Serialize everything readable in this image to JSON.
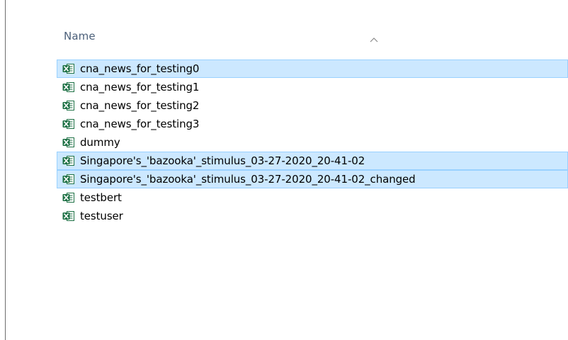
{
  "header": {
    "name_column": "Name"
  },
  "files": [
    {
      "name": "cna_news_for_testing0",
      "selected": true,
      "icon": "excel-file-icon"
    },
    {
      "name": "cna_news_for_testing1",
      "selected": false,
      "icon": "excel-file-icon"
    },
    {
      "name": "cna_news_for_testing2",
      "selected": false,
      "icon": "excel-file-icon"
    },
    {
      "name": "cna_news_for_testing3",
      "selected": false,
      "icon": "excel-file-icon"
    },
    {
      "name": "dummy",
      "selected": false,
      "icon": "excel-file-icon"
    },
    {
      "name": "Singapore's_'bazooka'_stimulus_03-27-2020_20-41-02",
      "selected": true,
      "icon": "excel-file-icon"
    },
    {
      "name": "Singapore's_'bazooka'_stimulus_03-27-2020_20-41-02_changed",
      "selected": true,
      "icon": "excel-file-icon"
    },
    {
      "name": "testbert",
      "selected": false,
      "icon": "excel-file-icon"
    },
    {
      "name": "testuser",
      "selected": false,
      "icon": "excel-file-icon"
    }
  ],
  "colors": {
    "selection_fill": "#cce8ff",
    "selection_border": "#99d1ff",
    "header_text": "#4c607a",
    "excel_green": "#1e7145"
  }
}
